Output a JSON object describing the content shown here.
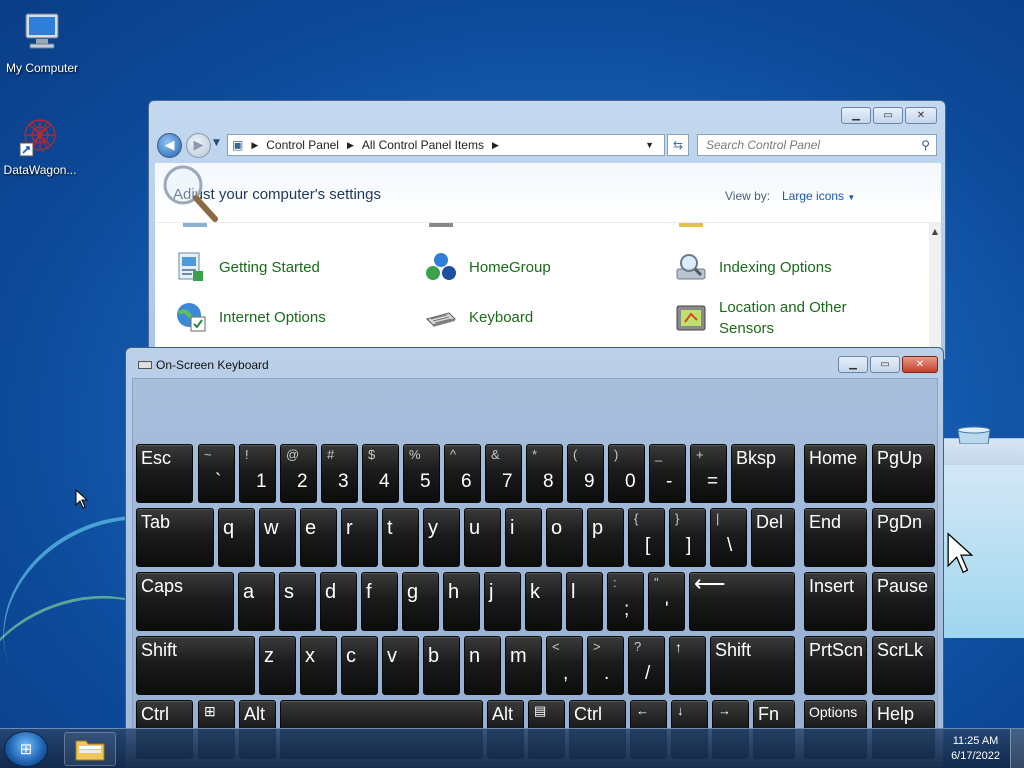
{
  "desktop": {
    "icons": [
      {
        "label": "My Computer",
        "icon": "computer-icon"
      },
      {
        "label": "DataWagon...",
        "icon": "datawagon-shortcut-icon"
      }
    ]
  },
  "control_panel": {
    "breadcrumb": [
      "Control Panel",
      "All Control Panel Items"
    ],
    "search_placeholder": "Search Control Panel",
    "heading": "Adjust your computer's settings",
    "view_by_label": "View by:",
    "view_by_value": "Large icons",
    "items": [
      {
        "label": "Getting Started",
        "icon": "getting-started-icon"
      },
      {
        "label": "HomeGroup",
        "icon": "homegroup-icon"
      },
      {
        "label": "Indexing Options",
        "icon": "indexing-options-icon"
      },
      {
        "label": "Internet Options",
        "icon": "internet-options-icon"
      },
      {
        "label": "Keyboard",
        "icon": "keyboard-icon"
      },
      {
        "label": "Location and Other Sensors",
        "icon": "location-sensors-icon"
      }
    ]
  },
  "osk": {
    "title": "On-Screen Keyboard",
    "keys": {
      "esc": "Esc",
      "tilde_top": "~",
      "tilde_bot": "`",
      "n1_top": "!",
      "n1": "1",
      "n2_top": "@",
      "n2": "2",
      "n3_top": "#",
      "n3": "3",
      "n4_top": "$",
      "n4": "4",
      "n5_top": "%",
      "n5": "5",
      "n6_top": "^",
      "n6": "6",
      "n7_top": "&",
      "n7": "7",
      "n8_top": "*",
      "n8": "8",
      "n9_top": "(",
      "n9": "9",
      "n0_top": ")",
      "n0": "0",
      "minus_top": "_",
      "minus": "-",
      "eq_top": "+",
      "eq": "=",
      "bksp": "Bksp",
      "home": "Home",
      "pgup": "PgUp",
      "tab": "Tab",
      "q": "q",
      "w": "w",
      "e": "e",
      "r": "r",
      "t": "t",
      "y": "y",
      "u": "u",
      "i": "i",
      "o": "o",
      "p": "p",
      "lbr_top": "{",
      "lbr": "[",
      "rbr_top": "}",
      "rbr": "]",
      "bsl_top": "|",
      "bsl": "\\",
      "del": "Del",
      "end": "End",
      "pgdn": "PgDn",
      "caps": "Caps",
      "a": "a",
      "s": "s",
      "d": "d",
      "f": "f",
      "g": "g",
      "h": "h",
      "j": "j",
      "k": "k",
      "l": "l",
      "semi_top": ":",
      "semi": ";",
      "quote_top": "\"",
      "quote": "'",
      "enter": "⟵",
      "insert": "Insert",
      "pause": "Pause",
      "lshift": "Shift",
      "z": "z",
      "x": "x",
      "c": "c",
      "v": "v",
      "b": "b",
      "n": "n",
      "m": "m",
      "comma_top": "<",
      "comma": ",",
      "period_top": ">",
      "period": ".",
      "slash_top": "?",
      "slash": "/",
      "up": "↑",
      "rshift": "Shift",
      "prtscn": "PrtScn",
      "scrlk": "ScrLk",
      "lctrl": "Ctrl",
      "win": "⊞",
      "lalt": "Alt",
      "ralt": "Alt",
      "menu": "▤",
      "rctrl": "Ctrl",
      "left": "←",
      "down": "↓",
      "right": "→",
      "fn": "Fn",
      "options": "Options",
      "help": "Help"
    }
  },
  "taskbar": {
    "time": "11:25 AM",
    "date": "6/17/2022"
  }
}
